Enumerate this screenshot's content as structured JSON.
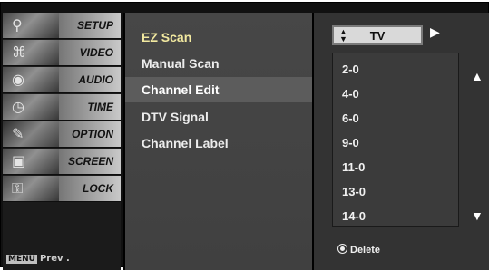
{
  "menu": {
    "items": [
      {
        "label": "SETUP",
        "icon": "satellite-dish-icon",
        "glyph": "⚲"
      },
      {
        "label": "VIDEO",
        "icon": "film-reel-icon",
        "glyph": "⌘"
      },
      {
        "label": "AUDIO",
        "icon": "speaker-icon",
        "glyph": "◉"
      },
      {
        "label": "TIME",
        "icon": "clock-icon",
        "glyph": "◷"
      },
      {
        "label": "OPTION",
        "icon": "option-tag-icon",
        "glyph": "✎"
      },
      {
        "label": "SCREEN",
        "icon": "screen-icon",
        "glyph": "▣"
      },
      {
        "label": "LOCK",
        "icon": "lock-icon",
        "glyph": "⚿"
      }
    ],
    "prev": {
      "key_label": "MENU",
      "text": "Prev ."
    }
  },
  "submenu": {
    "items": [
      {
        "label": "EZ Scan"
      },
      {
        "label": "Manual Scan"
      },
      {
        "label": "Channel Edit"
      },
      {
        "label": "DTV Signal"
      },
      {
        "label": "Channel Label"
      }
    ],
    "selected_index": 2
  },
  "channel_edit": {
    "source_selector": "TV",
    "channels": [
      "2-0",
      "4-0",
      "6-0",
      "9-0",
      "11-0",
      "13-0",
      "14-0"
    ],
    "delete_label": "Delete"
  }
}
